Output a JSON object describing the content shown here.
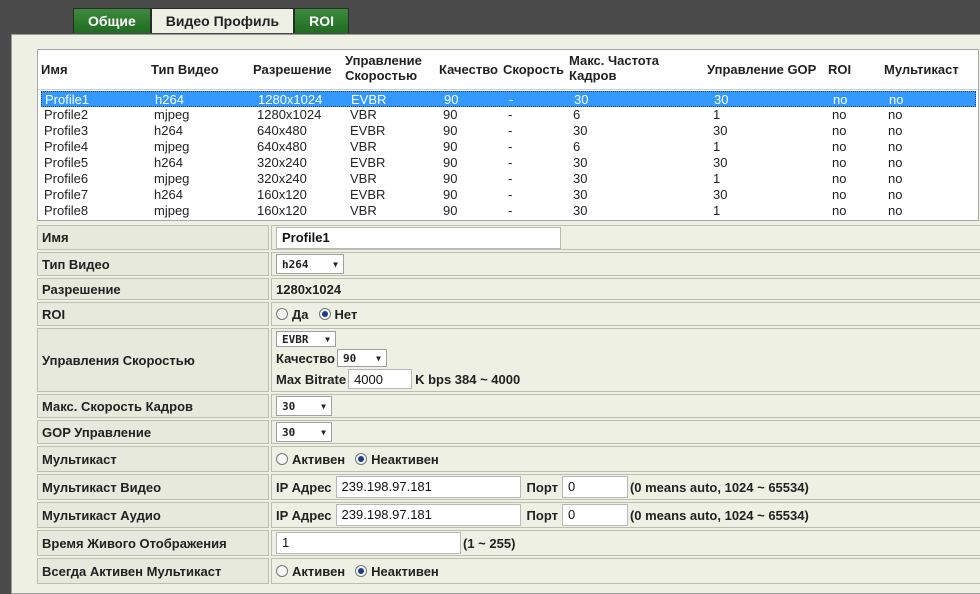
{
  "tabs": [
    {
      "label": "Общие",
      "active": false
    },
    {
      "label": "Видео Профиль",
      "active": true
    },
    {
      "label": "ROI",
      "active": false
    }
  ],
  "profile_table": {
    "columns": [
      "Имя",
      "Тип Видео",
      "Разрешение",
      "Управление Скоростью",
      "Качество",
      "Скорость",
      "Макс. Частота Кадров",
      "Управление GOP",
      "ROI",
      "Мультикаст"
    ],
    "col_video_mgmt_lines": [
      "Управление",
      "Скоростью"
    ],
    "col_fps_lines": [
      "Макс. Частота",
      "Кадров"
    ],
    "rows": [
      [
        "Profile1",
        "h264",
        "1280x1024",
        "EVBR",
        "90",
        "-",
        "30",
        "30",
        "no",
        "no"
      ],
      [
        "Profile2",
        "mjpeg",
        "1280x1024",
        "VBR",
        "90",
        "-",
        "6",
        "1",
        "no",
        "no"
      ],
      [
        "Profile3",
        "h264",
        "640x480",
        "EVBR",
        "90",
        "-",
        "30",
        "30",
        "no",
        "no"
      ],
      [
        "Profile4",
        "mjpeg",
        "640x480",
        "VBR",
        "90",
        "-",
        "6",
        "1",
        "no",
        "no"
      ],
      [
        "Profile5",
        "h264",
        "320x240",
        "EVBR",
        "90",
        "-",
        "30",
        "30",
        "no",
        "no"
      ],
      [
        "Profile6",
        "mjpeg",
        "320x240",
        "VBR",
        "90",
        "-",
        "30",
        "1",
        "no",
        "no"
      ],
      [
        "Profile7",
        "h264",
        "160x120",
        "EVBR",
        "90",
        "-",
        "30",
        "30",
        "no",
        "no"
      ],
      [
        "Profile8",
        "mjpeg",
        "160x120",
        "VBR",
        "90",
        "-",
        "30",
        "1",
        "no",
        "no"
      ]
    ],
    "selected_row": 0
  },
  "form": {
    "name_label": "Имя",
    "name_value": "Profile1",
    "video_type_label": "Тип Видео",
    "video_type_value": "h264",
    "resolution_label": "Разрешение",
    "resolution_value": "1280x1024",
    "roi_label": "ROI",
    "roi_yes": "Да",
    "roi_no": "Нет",
    "rate_control_label": "Управления Скоростью",
    "rate_mode_value": "EVBR",
    "quality_label": "Качество",
    "quality_value": "90",
    "max_bitrate_label": "Max Bitrate",
    "max_bitrate_value": "4000",
    "bitrate_range": "K bps 384 ~ 4000",
    "max_fps_label": "Макс. Скорость Кадров",
    "max_fps_value": "30",
    "gop_label": "GOP Управление",
    "gop_value": "30",
    "multicast_label": "Мультикаст",
    "active_label": "Активен",
    "inactive_label": "Неактивен",
    "mc_video_label": "Мультикаст Видео",
    "mc_audio_label": "Мультикаст Аудио",
    "ip_label": "IP Адрес",
    "mc_video_ip": "239.198.97.181",
    "mc_audio_ip": "239.198.97.181",
    "port_label": "Порт",
    "mc_video_port": "0",
    "mc_audio_port": "0",
    "port_hint": "(0 means auto, 1024 ~ 65534)",
    "live_time_label": "Время Живого Отображения",
    "live_time_value": "1",
    "live_time_hint": "(1 ~ 255)",
    "always_mc_label": "Всегда Активен Мультикаст"
  }
}
